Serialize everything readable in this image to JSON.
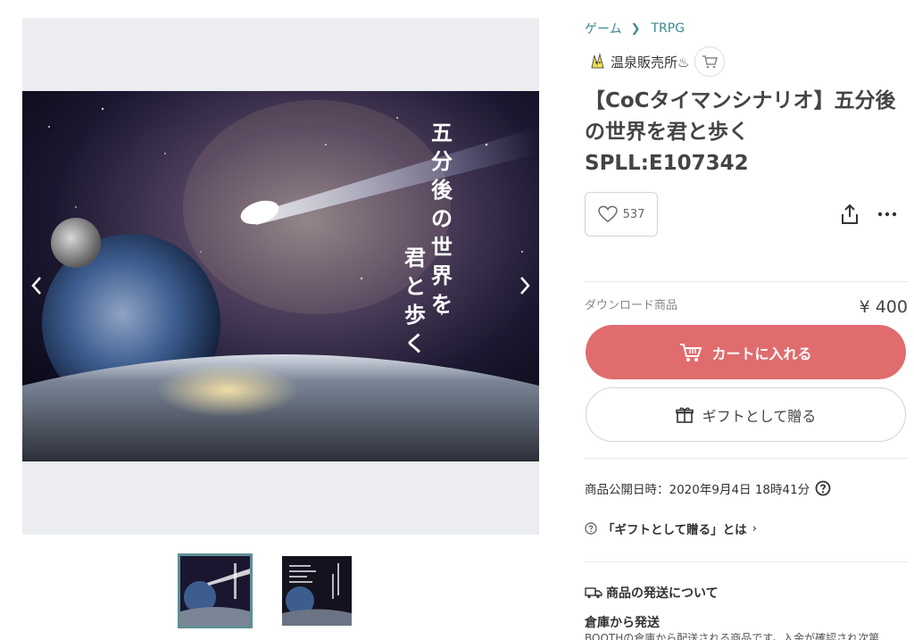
{
  "breadcrumb": [
    {
      "label": "ゲーム"
    },
    {
      "label": "TRPG"
    }
  ],
  "shop": {
    "name": "温泉販売所♨",
    "avatar_icon": "shop-avatar-icon",
    "cart_icon": "cart-icon"
  },
  "product": {
    "title": "【CoCタイマンシナリオ】五分後の世界を君と歩く SPLL:E107342",
    "image_caption_vertical": [
      "五分後の世界を",
      "君と歩く"
    ],
    "likes": "537",
    "type_label": "ダウンロード商品",
    "price": "¥ 400"
  },
  "actions": {
    "cart_label": "カートに入れる",
    "gift_label": "ギフトとして贈る"
  },
  "meta": {
    "published": "商品公開日時：2020年9月4日 18時41分",
    "gift_about": "「ギフトとして贈る」とは"
  },
  "shipping": {
    "heading": "商品の発送について",
    "method": "倉庫から発送",
    "description": "BOOTHの倉庫から配送される商品です。入金が確認され次第"
  },
  "colors": {
    "accent": "#e06c6e",
    "link": "#3a8a8f",
    "thumb_border": "#5e8f94"
  }
}
